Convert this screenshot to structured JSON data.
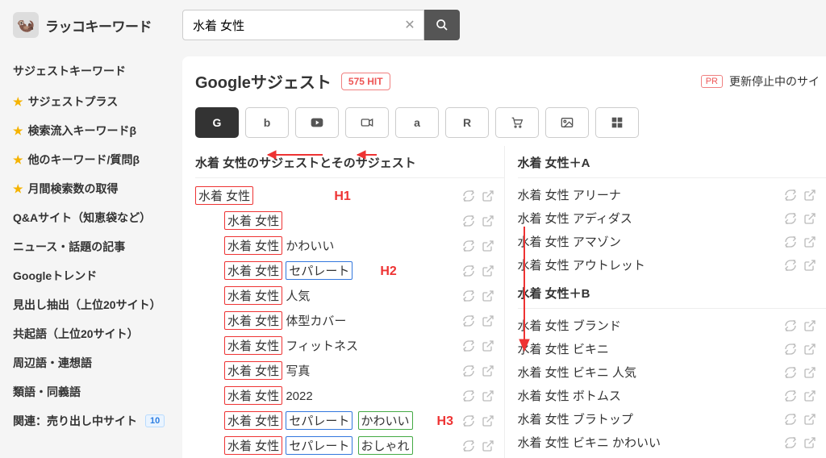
{
  "header": {
    "logo_text": "ラッコキーワード",
    "search_value": "水着 女性"
  },
  "sidebar": {
    "title": "サジェストキーワード",
    "items": [
      {
        "label": "サジェストプラス",
        "star": true
      },
      {
        "label": "検索流入キーワードβ",
        "star": true
      },
      {
        "label": "他のキーワード/質問β",
        "star": true
      },
      {
        "label": "月間検索数の取得",
        "star": true
      },
      {
        "label": "Q&Aサイト（知恵袋など）",
        "star": false
      },
      {
        "label": "ニュース・話題の記事",
        "star": false
      },
      {
        "label": "Googleトレンド",
        "star": false
      },
      {
        "label": "見出し抽出（上位20サイト）",
        "star": false
      },
      {
        "label": "共起語（上位20サイト）",
        "star": false
      },
      {
        "label": "周辺語・連想語",
        "star": false
      },
      {
        "label": "類語・同義語",
        "star": false
      },
      {
        "label": "関連：売り出し中サイト",
        "star": false,
        "badge": "10"
      }
    ]
  },
  "main": {
    "title": "Googleサジェスト",
    "hit_badge": "575 HIT",
    "pr_tag": "PR",
    "pr_text": "更新停止中のサイ"
  },
  "engines": [
    "G",
    "b",
    "▶",
    "■",
    "a",
    "R",
    "🛒",
    "🖼",
    "⊞"
  ],
  "left_col": {
    "head": "水着 女性のサジェストとそのサジェスト",
    "root": "水着 女性",
    "children": [
      {
        "t": "水着 女性"
      },
      {
        "t": "水着 女性 かわいい"
      },
      {
        "p1": "水着 女性",
        "p2": "セパレート",
        "is_h2": true
      },
      {
        "t": "水着 女性 人気"
      },
      {
        "t": "水着 女性 体型カバー"
      },
      {
        "t": "水着 女性 フィットネス"
      },
      {
        "t": "水着 女性 写真"
      },
      {
        "t": "水着 女性 2022"
      },
      {
        "p1": "水着 女性",
        "p2": "セパレート",
        "p3": "かわいい",
        "is_h3": true
      },
      {
        "p1": "水着 女性",
        "p2": "セパレート",
        "p3": "おしゃれ",
        "is_h3b": true
      }
    ],
    "labels": {
      "h1": "H1",
      "h2": "H2",
      "h3": "H3"
    }
  },
  "right_col": {
    "sections": [
      {
        "head": "水着 女性＋A",
        "rows": [
          "水着 女性 アリーナ",
          "水着 女性 アディダス",
          "水着 女性 アマゾン",
          "水着 女性 アウトレット"
        ]
      },
      {
        "head": "水着 女性＋B",
        "rows": [
          "水着 女性 ブランド",
          "水着 女性 ビキニ",
          "水着 女性 ビキニ 人気",
          "水着 女性 ボトムス",
          "水着 女性 ブラトップ",
          "水着 女性 ビキニ かわいい"
        ]
      }
    ]
  }
}
